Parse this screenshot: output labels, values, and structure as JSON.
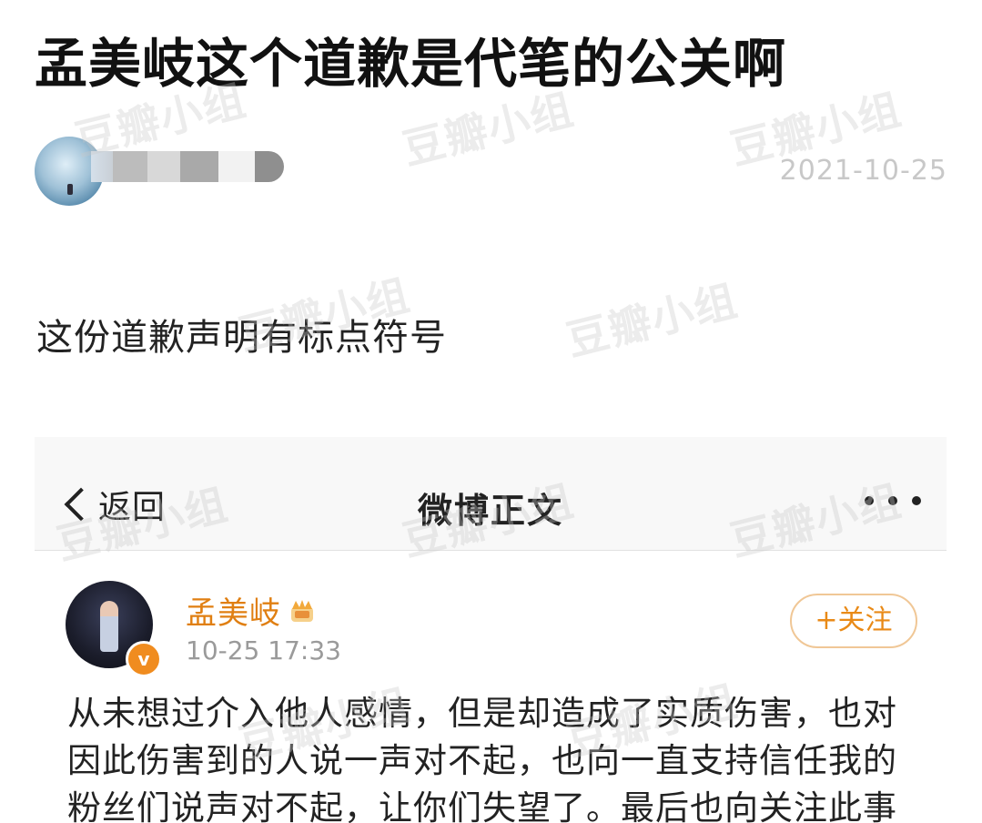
{
  "post": {
    "title": "孟美岐这个道歉是代笔的公关啊",
    "date": "2021-10-25",
    "body": "这份道歉声明有标点符号"
  },
  "watermark": {
    "text": "豆瓣小组"
  },
  "screenshot": {
    "back_label": "返回",
    "title": "微博正文",
    "user_name": "孟美岐",
    "time": "10-25 17:33",
    "verified_mark": "v",
    "follow_label": "+关注",
    "text_lines": [
      "从未想过介入他人感情，但是却造成了实质伤害，也对",
      "因此伤害到的人说一声对不起，也向一直支持信任我的",
      "粉丝们说声对不起，让你们失望了。最后也向关注此事"
    ]
  },
  "colors": {
    "weibo_orange": "#e07f12",
    "date_gray": "#c8c8c8",
    "follow_border": "#f0c796"
  }
}
